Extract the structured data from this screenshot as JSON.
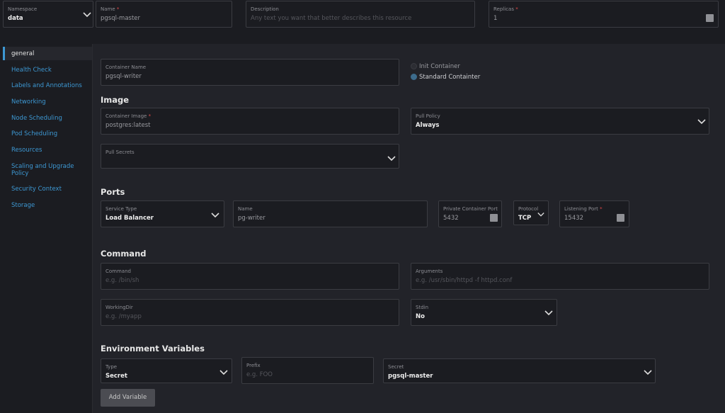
{
  "top": {
    "namespace": {
      "label": "Namespace",
      "value": "data"
    },
    "name": {
      "label": "Name",
      "required": "*",
      "value": "pgsql-master"
    },
    "description": {
      "label": "Description",
      "placeholder": "Any text you want that better describes this resource"
    },
    "replicas": {
      "label": "Replicas",
      "required": "*",
      "value": "1"
    }
  },
  "sidebar": {
    "items": [
      {
        "label": "general"
      },
      {
        "label": "Health Check"
      },
      {
        "label": "Labels and Annotations"
      },
      {
        "label": "Networking"
      },
      {
        "label": "Node Scheduling"
      },
      {
        "label": "Pod Scheduling"
      },
      {
        "label": "Resources"
      },
      {
        "label": "Scaling and Upgrade Policy"
      },
      {
        "label": "Security Context"
      },
      {
        "label": "Storage"
      }
    ]
  },
  "container": {
    "name": {
      "label": "Container Name",
      "value": "pgsql-writer"
    },
    "init_label": "Init Container",
    "standard_label": "Standard Containter"
  },
  "image": {
    "section": "Image",
    "container_image": {
      "label": "Container Image",
      "required": "*",
      "value": "postgres:latest"
    },
    "pull_policy": {
      "label": "Pull Policy",
      "value": "Always"
    },
    "pull_secrets": {
      "label": "Pull Secrets"
    }
  },
  "ports": {
    "section": "Ports",
    "service_type": {
      "label": "Service Type",
      "value": "Load Balancer"
    },
    "name": {
      "label": "Name",
      "value": "pg-writer"
    },
    "private_port": {
      "label": "Private Container Port",
      "value": "5432"
    },
    "protocol": {
      "label": "Protocol",
      "value": "TCP"
    },
    "listening_port": {
      "label": "Listening Port",
      "required": "*",
      "value": "15432"
    }
  },
  "command": {
    "section": "Command",
    "command": {
      "label": "Command",
      "placeholder": "e.g. /bin/sh"
    },
    "arguments": {
      "label": "Arguments",
      "placeholder": "e.g. /usr/sbin/httpd -f httpd.conf"
    },
    "workingdir": {
      "label": "WorkingDir",
      "placeholder": "e.g. /myapp"
    },
    "stdin": {
      "label": "Stdin",
      "value": "No"
    }
  },
  "env": {
    "section": "Environment Variables",
    "type": {
      "label": "Type",
      "value": "Secret"
    },
    "prefix": {
      "label": "Prefix",
      "placeholder": "e.g. FOO"
    },
    "secret": {
      "label": "Secret",
      "value": "pgsql-master"
    },
    "add_button": "Add Variable"
  },
  "colors": {
    "accent": "#3d98d3",
    "required": "#e64a4a",
    "background": "#1b1c21",
    "panel": "#222329"
  },
  "icons": {
    "dropdown": "chevron-down-icon",
    "stepper": "stepper-icon",
    "radio": "radio-icon"
  }
}
